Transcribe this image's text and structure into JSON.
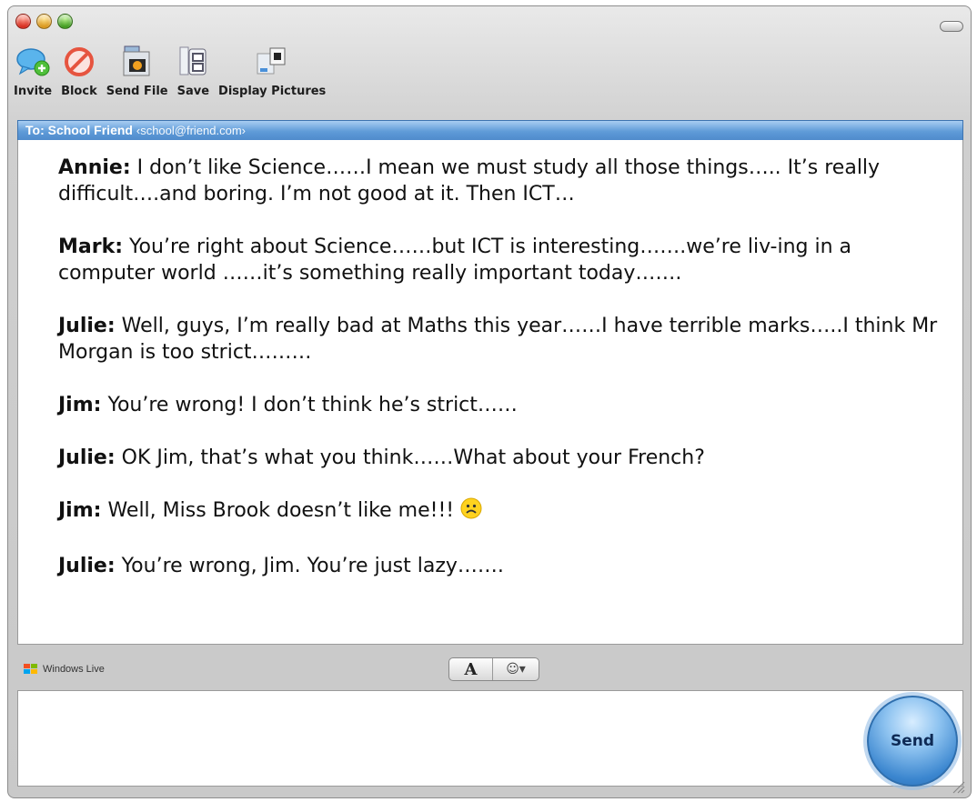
{
  "toolbar": {
    "items": [
      {
        "label": "Invite",
        "icon": "invite-icon"
      },
      {
        "label": "Block",
        "icon": "block-icon"
      },
      {
        "label": "Send File",
        "icon": "send-file-icon"
      },
      {
        "label": "Save",
        "icon": "save-icon"
      },
      {
        "label": "Display Pictures",
        "icon": "display-pictures-icon"
      }
    ]
  },
  "recipient": {
    "prefix": "To: School Friend",
    "address": "‹school@friend.com›"
  },
  "messages": [
    {
      "speaker": "Annie:",
      "text": " I don’t like Science……I mean we must study all those things….. It’s really difficult….and boring. I’m not good at it. Then ICT…"
    },
    {
      "speaker": "Mark:",
      "text": " You’re right about Science……but ICT is interesting…….we’re liv-ing in a computer world ……it’s something really important today……."
    },
    {
      "speaker": "Julie:",
      "text": " Well, guys, I’m really bad at Maths this year……I have terrible marks…..I think Mr Morgan is too strict………"
    },
    {
      "speaker": "Jim:",
      "text": " You’re wrong!  I don’t think he’s strict……"
    },
    {
      "speaker": "Julie:",
      "text": " OK Jim, that’s what you think……What about your French?"
    },
    {
      "speaker": "Jim:",
      "text": " Well, Miss Brook doesn’t like me!!! "
    },
    {
      "speaker": "Julie:",
      "text": " You’re wrong, Jim. You’re just lazy……."
    }
  ],
  "brand": {
    "label": "Windows Live"
  },
  "format": {
    "font_label": "A",
    "emoticon_label": "☺▾"
  },
  "send": {
    "label": "Send"
  },
  "colors": {
    "accent": "#5f9bd8",
    "send": "#3b86cf"
  }
}
